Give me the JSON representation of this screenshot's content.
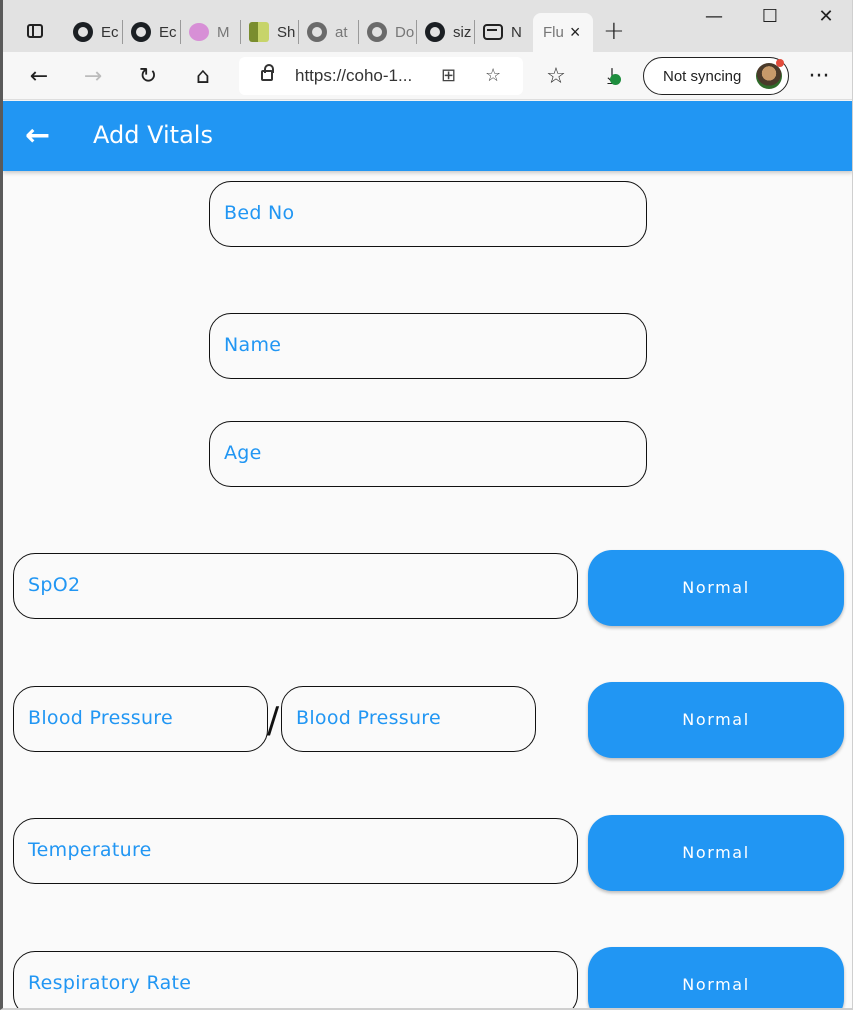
{
  "browser": {
    "tabs": [
      {
        "icon": "github-icon",
        "label": "Ec"
      },
      {
        "icon": "github-icon",
        "label": "Ec"
      },
      {
        "icon": "circle-icon",
        "label": "M"
      },
      {
        "icon": "book-icon",
        "label": "Sh"
      },
      {
        "icon": "github-icon",
        "label": "at"
      },
      {
        "icon": "github-icon",
        "label": "Do"
      },
      {
        "icon": "github-icon",
        "label": "siz"
      },
      {
        "icon": "app-icon",
        "label": "N"
      }
    ],
    "active_tab": {
      "label": "Flu",
      "close": "×"
    },
    "new_tab": "+",
    "url": "https://coho-1...",
    "sync_label": "Not syncing",
    "window_controls": {
      "minimize": "—",
      "maximize": "☐",
      "close": "✕"
    },
    "more": "···"
  },
  "app": {
    "title": "Add Vitals",
    "back": "←",
    "accent": "#2196f3",
    "fields": {
      "bed_no": "Bed No",
      "name": "Name",
      "age": "Age",
      "spo2": "SpO2",
      "bp_systolic": "Blood Pressure",
      "bp_separator": "/",
      "bp_diastolic": "Blood Pressure",
      "temperature": "Temperature",
      "respiratory_rate": "Respiratory Rate"
    },
    "status": {
      "spo2": "Normal",
      "blood_pressure": "Normal",
      "temperature": "Normal",
      "respiratory_rate": "Normal"
    }
  }
}
